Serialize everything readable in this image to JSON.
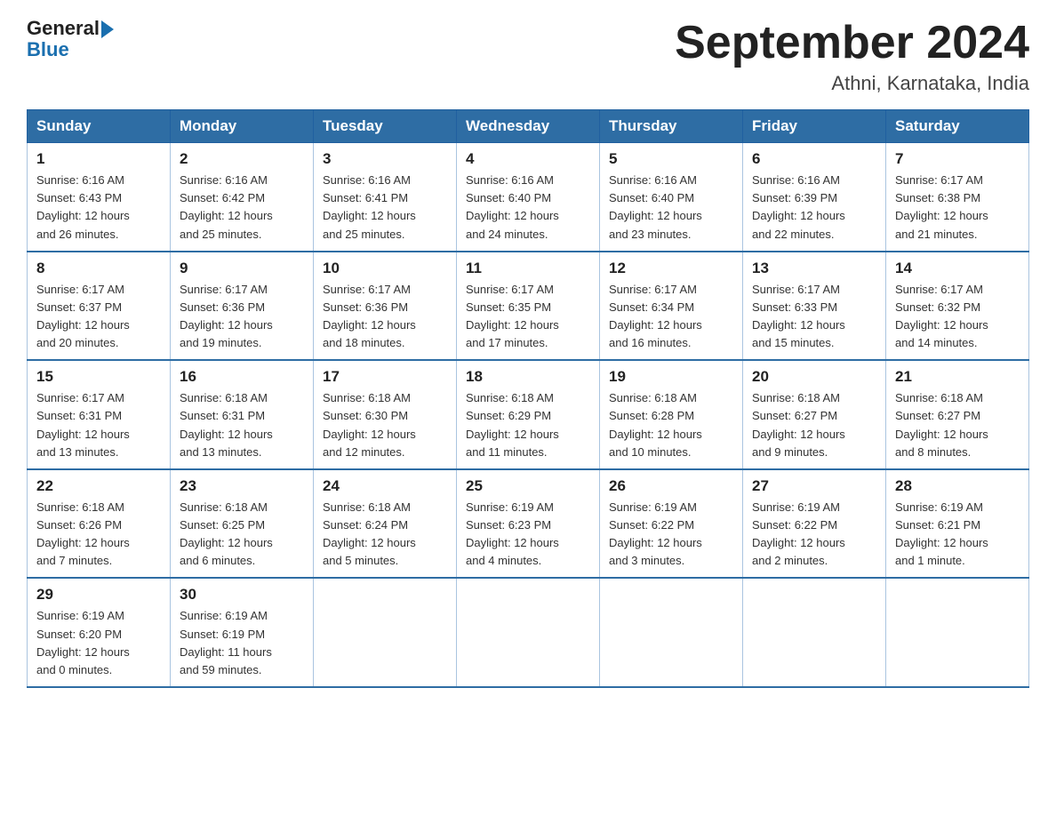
{
  "logo": {
    "text_general": "General",
    "text_blue": "Blue"
  },
  "header": {
    "title": "September 2024",
    "subtitle": "Athni, Karnataka, India"
  },
  "days_of_week": [
    "Sunday",
    "Monday",
    "Tuesday",
    "Wednesday",
    "Thursday",
    "Friday",
    "Saturday"
  ],
  "weeks": [
    [
      {
        "day": "1",
        "sunrise": "6:16 AM",
        "sunset": "6:43 PM",
        "daylight": "12 hours and 26 minutes."
      },
      {
        "day": "2",
        "sunrise": "6:16 AM",
        "sunset": "6:42 PM",
        "daylight": "12 hours and 25 minutes."
      },
      {
        "day": "3",
        "sunrise": "6:16 AM",
        "sunset": "6:41 PM",
        "daylight": "12 hours and 25 minutes."
      },
      {
        "day": "4",
        "sunrise": "6:16 AM",
        "sunset": "6:40 PM",
        "daylight": "12 hours and 24 minutes."
      },
      {
        "day": "5",
        "sunrise": "6:16 AM",
        "sunset": "6:40 PM",
        "daylight": "12 hours and 23 minutes."
      },
      {
        "day": "6",
        "sunrise": "6:16 AM",
        "sunset": "6:39 PM",
        "daylight": "12 hours and 22 minutes."
      },
      {
        "day": "7",
        "sunrise": "6:17 AM",
        "sunset": "6:38 PM",
        "daylight": "12 hours and 21 minutes."
      }
    ],
    [
      {
        "day": "8",
        "sunrise": "6:17 AM",
        "sunset": "6:37 PM",
        "daylight": "12 hours and 20 minutes."
      },
      {
        "day": "9",
        "sunrise": "6:17 AM",
        "sunset": "6:36 PM",
        "daylight": "12 hours and 19 minutes."
      },
      {
        "day": "10",
        "sunrise": "6:17 AM",
        "sunset": "6:36 PM",
        "daylight": "12 hours and 18 minutes."
      },
      {
        "day": "11",
        "sunrise": "6:17 AM",
        "sunset": "6:35 PM",
        "daylight": "12 hours and 17 minutes."
      },
      {
        "day": "12",
        "sunrise": "6:17 AM",
        "sunset": "6:34 PM",
        "daylight": "12 hours and 16 minutes."
      },
      {
        "day": "13",
        "sunrise": "6:17 AM",
        "sunset": "6:33 PM",
        "daylight": "12 hours and 15 minutes."
      },
      {
        "day": "14",
        "sunrise": "6:17 AM",
        "sunset": "6:32 PM",
        "daylight": "12 hours and 14 minutes."
      }
    ],
    [
      {
        "day": "15",
        "sunrise": "6:17 AM",
        "sunset": "6:31 PM",
        "daylight": "12 hours and 13 minutes."
      },
      {
        "day": "16",
        "sunrise": "6:18 AM",
        "sunset": "6:31 PM",
        "daylight": "12 hours and 13 minutes."
      },
      {
        "day": "17",
        "sunrise": "6:18 AM",
        "sunset": "6:30 PM",
        "daylight": "12 hours and 12 minutes."
      },
      {
        "day": "18",
        "sunrise": "6:18 AM",
        "sunset": "6:29 PM",
        "daylight": "12 hours and 11 minutes."
      },
      {
        "day": "19",
        "sunrise": "6:18 AM",
        "sunset": "6:28 PM",
        "daylight": "12 hours and 10 minutes."
      },
      {
        "day": "20",
        "sunrise": "6:18 AM",
        "sunset": "6:27 PM",
        "daylight": "12 hours and 9 minutes."
      },
      {
        "day": "21",
        "sunrise": "6:18 AM",
        "sunset": "6:27 PM",
        "daylight": "12 hours and 8 minutes."
      }
    ],
    [
      {
        "day": "22",
        "sunrise": "6:18 AM",
        "sunset": "6:26 PM",
        "daylight": "12 hours and 7 minutes."
      },
      {
        "day": "23",
        "sunrise": "6:18 AM",
        "sunset": "6:25 PM",
        "daylight": "12 hours and 6 minutes."
      },
      {
        "day": "24",
        "sunrise": "6:18 AM",
        "sunset": "6:24 PM",
        "daylight": "12 hours and 5 minutes."
      },
      {
        "day": "25",
        "sunrise": "6:19 AM",
        "sunset": "6:23 PM",
        "daylight": "12 hours and 4 minutes."
      },
      {
        "day": "26",
        "sunrise": "6:19 AM",
        "sunset": "6:22 PM",
        "daylight": "12 hours and 3 minutes."
      },
      {
        "day": "27",
        "sunrise": "6:19 AM",
        "sunset": "6:22 PM",
        "daylight": "12 hours and 2 minutes."
      },
      {
        "day": "28",
        "sunrise": "6:19 AM",
        "sunset": "6:21 PM",
        "daylight": "12 hours and 1 minute."
      }
    ],
    [
      {
        "day": "29",
        "sunrise": "6:19 AM",
        "sunset": "6:20 PM",
        "daylight": "12 hours and 0 minutes."
      },
      {
        "day": "30",
        "sunrise": "6:19 AM",
        "sunset": "6:19 PM",
        "daylight": "11 hours and 59 minutes."
      },
      null,
      null,
      null,
      null,
      null
    ]
  ],
  "labels": {
    "sunrise": "Sunrise:",
    "sunset": "Sunset:",
    "daylight": "Daylight:"
  }
}
